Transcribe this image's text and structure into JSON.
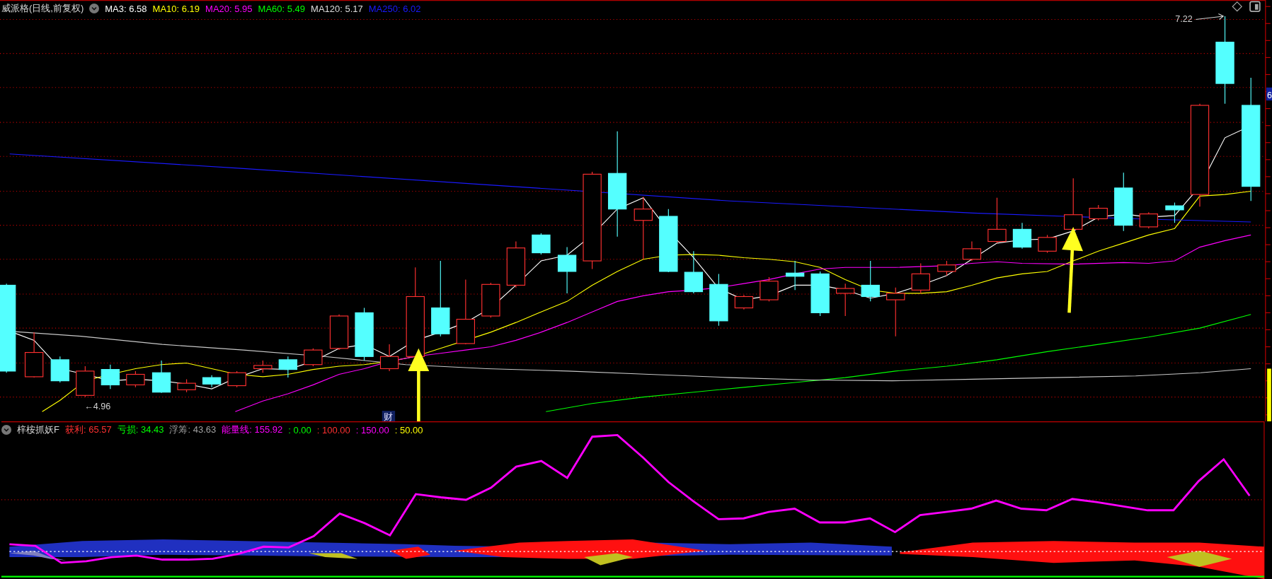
{
  "main_panel": {
    "title": "威派格(日线,前复权)",
    "averages": [
      {
        "label": "MA3: 6.58",
        "color": "#ffffff"
      },
      {
        "label": "MA10: 6.19",
        "color": "#ffff00"
      },
      {
        "label": "MA20: 5.95",
        "color": "#ff00ff"
      },
      {
        "label": "MA60: 5.49",
        "color": "#00ff00"
      },
      {
        "label": "MA120: 5.17",
        "color": "#dddddd"
      },
      {
        "label": "MA250: 6.02",
        "color": "#1a1aff"
      }
    ],
    "high_label": "7.22",
    "low_label": "←4.96",
    "finance_marker": "财",
    "price_tag": "6"
  },
  "sub_panel": {
    "title": "梓桉抓妖F",
    "values": [
      {
        "label": "获利: 65.57",
        "color": "#ff3030"
      },
      {
        "label": "亏损: 34.43",
        "color": "#00ff00"
      },
      {
        "label": "浮筹: 43.63",
        "color": "#a0a0a0"
      },
      {
        "label": "能量线: 155.92",
        "color": "#ff00ff"
      },
      {
        "label": ": 0.00",
        "color": "#00ff00"
      },
      {
        "label": ": 100.00",
        "color": "#ff3030"
      },
      {
        "label": ": 150.00",
        "color": "#ff00ff"
      },
      {
        "label": ": 50.00",
        "color": "#ffff00"
      }
    ]
  }
}
